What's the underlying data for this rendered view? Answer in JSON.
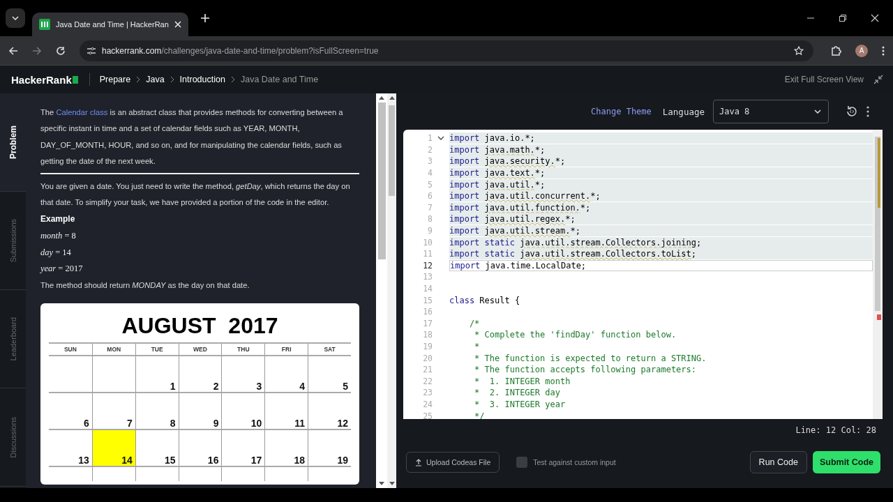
{
  "browser": {
    "tab_title": "Java Date and Time | HackerRan",
    "url_host": "hackerrank.com",
    "url_path": "/challenges/java-date-and-time/problem?isFullScreen=true",
    "avatar": "A"
  },
  "header": {
    "logo": "HackerRank",
    "breadcrumbs": [
      {
        "label": "Prepare",
        "current": false
      },
      {
        "label": "Java",
        "current": false
      },
      {
        "label": "Introduction",
        "current": false
      },
      {
        "label": "Java Date and Time",
        "current": true
      }
    ],
    "exit_fullscreen": "Exit Full Screen View"
  },
  "side_tabs": [
    {
      "label": "Problem",
      "selected": true
    },
    {
      "label": "Submissions",
      "selected": false
    },
    {
      "label": "Leaderboard",
      "selected": false
    },
    {
      "label": "Discussions",
      "selected": false
    }
  ],
  "problem": {
    "intro_before": "The ",
    "intro_link": "Calendar class",
    "intro_after": " is an abstract class that provides methods for converting between a specific instant in time and a set of calendar fields such as YEAR, MONTH, DAY_OF_MONTH, HOUR, and so on, and for manipulating the calendar fields, such as getting the date of the next week.",
    "task": "You are given a date. You just need to write the method, *getDay*, which returns the day on that date. To simplify your task, we have provided a portion of the code in the editor.",
    "example_heading": "Example",
    "example_lines": [
      "*month* = 8",
      "*day* = 14",
      "*year* = 2017"
    ],
    "result": "The method should return *MONDAY* as the day on that date.",
    "calendar": {
      "title": "AUGUST  2017",
      "weekdays": [
        "SUN",
        "MON",
        "TUE",
        "WED",
        "THU",
        "FRI",
        "SAT"
      ],
      "weeks": [
        [
          {
            "highlighted": false
          },
          {
            "highlighted": false
          },
          {
            "text": "1",
            "highlighted": false
          },
          {
            "text": "2",
            "highlighted": false
          },
          {
            "text": "3",
            "highlighted": false
          },
          {
            "text": "4",
            "highlighted": false
          },
          {
            "text": "5",
            "highlighted": false
          }
        ],
        [
          {
            "text": "6",
            "highlighted": false
          },
          {
            "text": "7",
            "highlighted": false
          },
          {
            "text": "8",
            "highlighted": false
          },
          {
            "text": "9",
            "highlighted": false
          },
          {
            "text": "10",
            "highlighted": false
          },
          {
            "text": "11",
            "highlighted": false
          },
          {
            "text": "12",
            "highlighted": false
          }
        ],
        [
          {
            "text": "13",
            "highlighted": false
          },
          {
            "text": "14",
            "highlighted": true
          },
          {
            "text": "15",
            "highlighted": false
          },
          {
            "text": "16",
            "highlighted": false
          },
          {
            "text": "17",
            "highlighted": false
          },
          {
            "text": "18",
            "highlighted": false
          },
          {
            "text": "19",
            "highlighted": false
          }
        ]
      ]
    }
  },
  "editor_toolbar": {
    "change_theme": "Change Theme",
    "language_label": "Language",
    "language": "Java 8"
  },
  "code": [
    {
      "number": "1",
      "foldable": true,
      "highlighted": true,
      "current": false,
      "parts": [
        {
          "kind": "keyword",
          "text": "import"
        },
        {
          "kind": "plain",
          "text": " java.io.*;"
        }
      ]
    },
    {
      "number": "2",
      "foldable": false,
      "highlighted": true,
      "current": false,
      "parts": [
        {
          "kind": "keyword",
          "text": "import "
        },
        {
          "kind": "squiggle",
          "text": "java.math."
        },
        {
          "kind": "plain",
          "text": "*;"
        }
      ]
    },
    {
      "number": "3",
      "foldable": false,
      "highlighted": true,
      "current": false,
      "parts": [
        {
          "kind": "keyword",
          "text": "import "
        },
        {
          "kind": "squiggle",
          "text": "java.security."
        },
        {
          "kind": "plain",
          "text": "*;"
        }
      ]
    },
    {
      "number": "4",
      "foldable": false,
      "highlighted": true,
      "current": false,
      "parts": [
        {
          "kind": "keyword",
          "text": "import "
        },
        {
          "kind": "squiggle",
          "text": "java.text."
        },
        {
          "kind": "plain",
          "text": "*;"
        }
      ]
    },
    {
      "number": "5",
      "foldable": false,
      "highlighted": true,
      "current": false,
      "parts": [
        {
          "kind": "keyword",
          "text": "import "
        },
        {
          "kind": "squiggle",
          "text": "java.util."
        },
        {
          "kind": "plain",
          "text": "*;"
        }
      ]
    },
    {
      "number": "6",
      "foldable": false,
      "highlighted": true,
      "current": false,
      "parts": [
        {
          "kind": "keyword",
          "text": "import "
        },
        {
          "kind": "squiggle",
          "text": "java.util.concurrent."
        },
        {
          "kind": "plain",
          "text": "*;"
        }
      ]
    },
    {
      "number": "7",
      "foldable": false,
      "highlighted": true,
      "current": false,
      "parts": [
        {
          "kind": "keyword",
          "text": "import "
        },
        {
          "kind": "squiggle",
          "text": "java.util.function."
        },
        {
          "kind": "plain",
          "text": "*;"
        }
      ]
    },
    {
      "number": "8",
      "foldable": false,
      "highlighted": true,
      "current": false,
      "parts": [
        {
          "kind": "keyword",
          "text": "import "
        },
        {
          "kind": "squiggle",
          "text": "java.util.regex."
        },
        {
          "kind": "plain",
          "text": "*;"
        }
      ]
    },
    {
      "number": "9",
      "foldable": false,
      "highlighted": true,
      "current": false,
      "parts": [
        {
          "kind": "keyword",
          "text": "import "
        },
        {
          "kind": "squiggle",
          "text": "java.util.stream."
        },
        {
          "kind": "plain",
          "text": "*;"
        }
      ]
    },
    {
      "number": "10",
      "foldable": false,
      "highlighted": true,
      "current": false,
      "parts": [
        {
          "kind": "keyword",
          "text": "import static "
        },
        {
          "kind": "squiggle",
          "text": "java.util.stream.Collectors.joining"
        },
        {
          "kind": "plain",
          "text": ";"
        }
      ]
    },
    {
      "number": "11",
      "foldable": false,
      "highlighted": true,
      "current": false,
      "parts": [
        {
          "kind": "keyword",
          "text": "import static "
        },
        {
          "kind": "squiggle",
          "text": "java.util.stream.Collectors.toList"
        },
        {
          "kind": "plain",
          "text": ";"
        }
      ]
    },
    {
      "number": "12",
      "foldable": false,
      "highlighted": false,
      "current": true,
      "parts": [
        {
          "kind": "keyword",
          "text": "import"
        },
        {
          "kind": "plain",
          "text": " java.time.LocalDate;"
        }
      ]
    },
    {
      "number": "13",
      "foldable": false,
      "highlighted": false,
      "current": false
    },
    {
      "number": "14",
      "foldable": false,
      "highlighted": false,
      "current": false
    },
    {
      "number": "15",
      "foldable": false,
      "highlighted": false,
      "current": false,
      "parts": [
        {
          "kind": "keyword",
          "text": "class"
        },
        {
          "kind": "plain",
          "text": " Result {"
        }
      ]
    },
    {
      "number": "16",
      "foldable": false,
      "highlighted": false,
      "current": false
    },
    {
      "number": "17",
      "foldable": false,
      "highlighted": false,
      "current": false,
      "parts": [
        {
          "kind": "comment",
          "text": "    /*"
        }
      ]
    },
    {
      "number": "18",
      "foldable": false,
      "highlighted": false,
      "current": false,
      "parts": [
        {
          "kind": "comment",
          "text": "     * Complete the 'findDay' function below."
        }
      ]
    },
    {
      "number": "19",
      "foldable": false,
      "highlighted": false,
      "current": false,
      "parts": [
        {
          "kind": "comment",
          "text": "     *"
        }
      ]
    },
    {
      "number": "20",
      "foldable": false,
      "highlighted": false,
      "current": false,
      "parts": [
        {
          "kind": "comment",
          "text": "     * The function is expected to return a STRING."
        }
      ]
    },
    {
      "number": "21",
      "foldable": false,
      "highlighted": false,
      "current": false,
      "parts": [
        {
          "kind": "comment",
          "text": "     * The function accepts following parameters:"
        }
      ]
    },
    {
      "number": "22",
      "foldable": false,
      "highlighted": false,
      "current": false,
      "parts": [
        {
          "kind": "comment",
          "text": "     *  1. INTEGER month"
        }
      ]
    },
    {
      "number": "23",
      "foldable": false,
      "highlighted": false,
      "current": false,
      "parts": [
        {
          "kind": "comment",
          "text": "     *  2. INTEGER day"
        }
      ]
    },
    {
      "number": "24",
      "foldable": false,
      "highlighted": false,
      "current": false,
      "parts": [
        {
          "kind": "comment",
          "text": "     *  3. INTEGER year"
        }
      ]
    },
    {
      "number": "25",
      "foldable": false,
      "highlighted": false,
      "current": false,
      "parts": [
        {
          "kind": "comment",
          "text": "     */"
        }
      ]
    }
  ],
  "cursor_position": "Line: 12 Col: 28",
  "footer": {
    "upload": "Upload Codeas File",
    "custom_input": {
      "label": "Test against custom input",
      "checked": false
    },
    "run": "Run Code",
    "submit": "Submit Code"
  }
}
